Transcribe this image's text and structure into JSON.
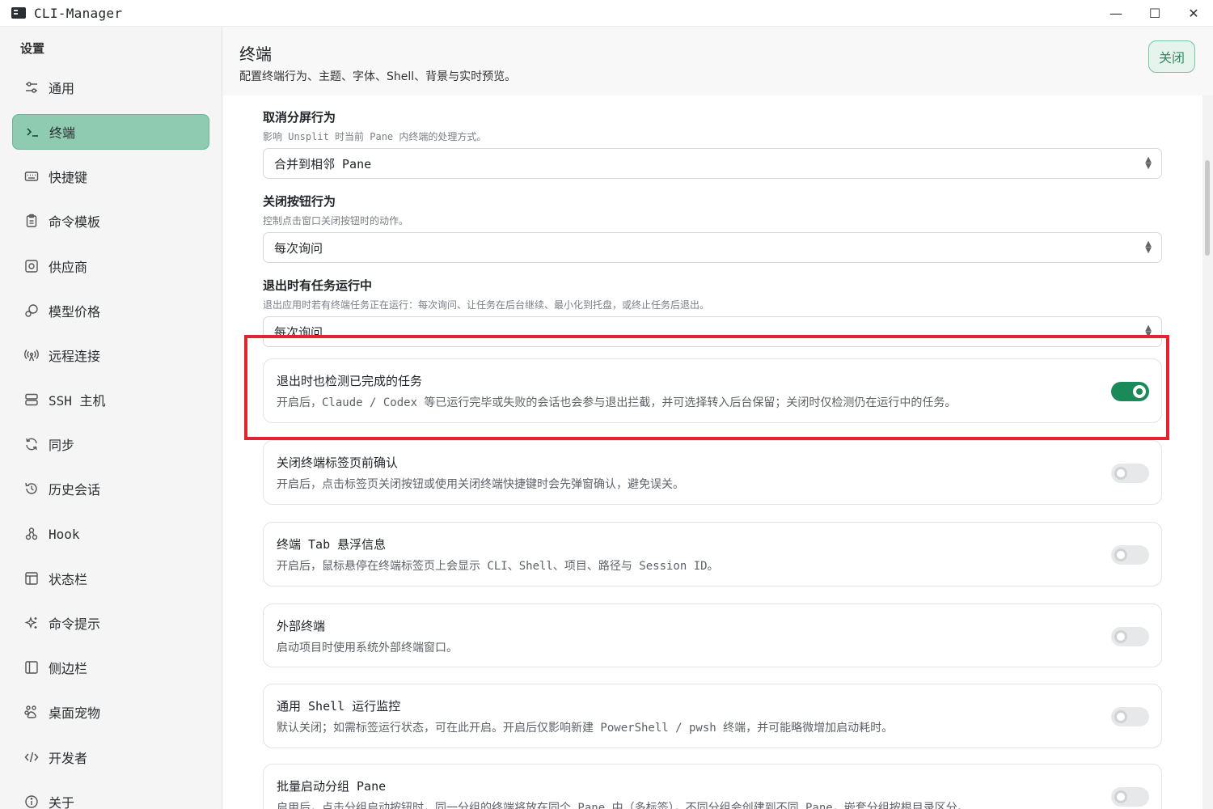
{
  "window": {
    "title": "CLI-Manager",
    "minimize": "—",
    "maximize": "☐",
    "close": "✕"
  },
  "sidebar": {
    "title": "设置",
    "items": [
      {
        "label": "通用",
        "icon": "sliders-icon"
      },
      {
        "label": "终端",
        "icon": "terminal-icon",
        "active": true
      },
      {
        "label": "快捷键",
        "icon": "keyboard-icon"
      },
      {
        "label": "命令模板",
        "icon": "clipboard-icon"
      },
      {
        "label": "供应商",
        "icon": "provider-icon"
      },
      {
        "label": "模型价格",
        "icon": "price-tag-icon"
      },
      {
        "label": "远程连接",
        "icon": "antenna-icon"
      },
      {
        "label": "SSH 主机",
        "icon": "server-icon"
      },
      {
        "label": "同步",
        "icon": "sync-icon"
      },
      {
        "label": "历史会话",
        "icon": "history-icon"
      },
      {
        "label": "Hook",
        "icon": "hook-icon"
      },
      {
        "label": "状态栏",
        "icon": "layout-icon"
      },
      {
        "label": "命令提示",
        "icon": "sparkle-icon"
      },
      {
        "label": "侧边栏",
        "icon": "sidebar-icon"
      },
      {
        "label": "桌面宠物",
        "icon": "paw-icon"
      },
      {
        "label": "开发者",
        "icon": "code-icon"
      },
      {
        "label": "关于",
        "icon": "info-icon"
      }
    ]
  },
  "header": {
    "title": "终端",
    "subtitle": "配置终端行为、主题、字体、Shell、背景与实时预览。",
    "close_label": "关闭"
  },
  "selects": [
    {
      "label": "取消分屏行为",
      "desc": "影响 Unsplit 时当前 Pane 内终端的处理方式。",
      "value": "合并到相邻 Pane"
    },
    {
      "label": "关闭按钮行为",
      "desc": "控制点击窗口关闭按钮时的动作。",
      "value": "每次询问"
    },
    {
      "label": "退出时有任务运行中",
      "desc": "退出应用时若有终端任务正在运行：每次询问、让任务在后台继续、最小化到托盘，或终止任务后退出。",
      "value": "每次询问"
    }
  ],
  "toggles": [
    {
      "label": "退出时也检测已完成的任务",
      "desc": "开启后，Claude / Codex 等已运行完毕或失败的会话也会参与退出拦截，并可选择转入后台保留；关闭时仅检测仍在运行中的任务。",
      "on": true
    },
    {
      "label": "关闭终端标签页前确认",
      "desc": "开启后，点击标签页关闭按钮或使用关闭终端快捷键时会先弹窗确认，避免误关。",
      "on": false
    },
    {
      "label": "终端 Tab 悬浮信息",
      "desc": "开启后，鼠标悬停在终端标签页上会显示 CLI、Shell、项目、路径与 Session ID。",
      "on": false
    },
    {
      "label": "外部终端",
      "desc": "启动项目时使用系统外部终端窗口。",
      "on": false
    },
    {
      "label": "通用 Shell 运行监控",
      "desc": "默认关闭；如需标签运行状态，可在此开启。开启后仅影响新建 PowerShell / pwsh 终端，并可能略微增加启动耗时。",
      "on": false
    },
    {
      "label": "批量启动分组 Pane",
      "desc": "启用后，点击分组启动按钮时，同一分组的终端将放在同个 Pane 中（多标签），不同分组会创建到不同 Pane，嵌套分组按根目录区分。",
      "on": false
    }
  ],
  "colors": {
    "accent": "#1b8a5a",
    "active_nav": "#8ecbb1",
    "highlight": "#e3232f"
  }
}
